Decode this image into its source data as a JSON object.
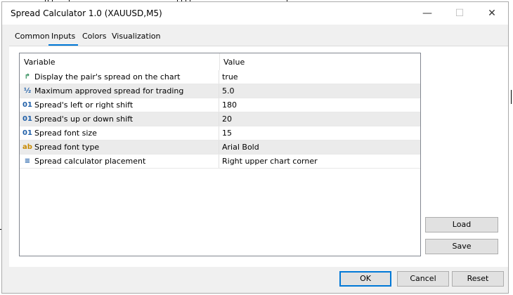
{
  "window": {
    "title": "Spread Calculator 1.0 (XAUUSD,M5)",
    "controls": {
      "minimize": "—",
      "maximize": "☐",
      "close": "✕"
    }
  },
  "tabs": [
    {
      "label": "Common",
      "active": false
    },
    {
      "label": "Inputs",
      "active": true
    },
    {
      "label": "Colors",
      "active": false
    },
    {
      "label": "Visualization",
      "active": false
    }
  ],
  "grid": {
    "headers": {
      "variable": "Variable",
      "value": "Value"
    },
    "rows": [
      {
        "icon": "bool-arrow-icon",
        "glyph": "↱",
        "color": "#2e8b57",
        "variable": "Display the pair's spread on the chart",
        "value": "true"
      },
      {
        "icon": "fraction-icon",
        "glyph": "½",
        "color": "#1f5fa8",
        "variable": "Maximum approved spread for trading",
        "value": "5.0"
      },
      {
        "icon": "integer-icon",
        "glyph": "01",
        "color": "#1f5fa8",
        "variable": "Spread's left or right shift",
        "value": "180"
      },
      {
        "icon": "integer-icon",
        "glyph": "01",
        "color": "#1f5fa8",
        "variable": "Spread's up or down shift",
        "value": "20"
      },
      {
        "icon": "integer-icon",
        "glyph": "01",
        "color": "#1f5fa8",
        "variable": "Spread font size",
        "value": "15"
      },
      {
        "icon": "string-icon",
        "glyph": "ab",
        "color": "#c88a00",
        "variable": "Spread font type",
        "value": "Arial Bold"
      },
      {
        "icon": "enum-icon",
        "glyph": "≡",
        "color": "#1f5fa8",
        "variable": "Spread calculator placement",
        "value": "Right upper chart corner"
      }
    ]
  },
  "side_buttons": {
    "load": "Load",
    "save": "Save"
  },
  "footer_buttons": {
    "ok": "OK",
    "cancel": "Cancel",
    "reset": "Reset"
  }
}
